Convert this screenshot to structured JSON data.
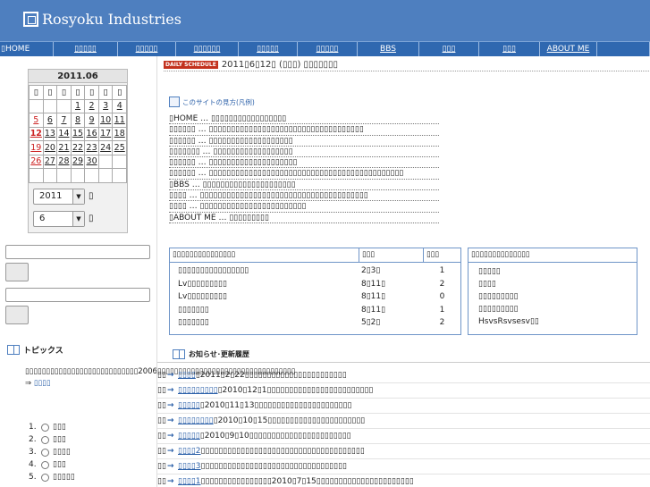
{
  "header": {
    "title": "Rosyoku Industries"
  },
  "nav": [
    {
      "label": "▯HOME",
      "w": 60
    },
    {
      "label": "▯▯▯▯▯",
      "w": 72
    },
    {
      "label": "▯▯▯▯▯",
      "w": 65
    },
    {
      "label": "▯▯▯▯▯▯",
      "w": 70
    },
    {
      "label": "▯▯▯▯▯",
      "w": 66
    },
    {
      "label": "▯▯▯▯▯",
      "w": 67
    },
    {
      "label": "BBS",
      "w": 69
    },
    {
      "label": "▯▯▯",
      "w": 67
    },
    {
      "label": "▯▯▯",
      "w": 68
    },
    {
      "label": "ABOUT ME",
      "w": 64
    },
    {
      "label": "",
      "w": 59
    }
  ],
  "calendar": {
    "title": "2011.06",
    "weekdays": [
      "▯",
      "▯",
      "▯",
      "▯",
      "▯",
      "▯",
      "▯"
    ],
    "weeks": [
      [
        "",
        "",
        "",
        "1",
        "2",
        "3",
        "4"
      ],
      [
        "5",
        "6",
        "7",
        "8",
        "9",
        "10",
        "11"
      ],
      [
        "12",
        "13",
        "14",
        "15",
        "16",
        "17",
        "18"
      ],
      [
        "19",
        "20",
        "21",
        "22",
        "23",
        "24",
        "25"
      ],
      [
        "26",
        "27",
        "28",
        "29",
        "30",
        "",
        ""
      ],
      [
        "",
        "",
        "",
        "",
        "",
        "",
        ""
      ]
    ],
    "today": "12",
    "year_select": "2011",
    "month_select": "6",
    "year_suffix": "▯",
    "month_suffix": "▯"
  },
  "topics": {
    "heading": "トピックス",
    "text": "▯▯▯▯▯▯▯▯▯▯▯▯▯▯▯▯▯▯▯▯▯▯▯▯▯▯▯2006▯▯▯▯▯▯▯▯▯▯▯▯▯▯▯▯▯▯▯▯▯▯▯▯▯▯▯▯▯▯▯▯▯ ⇒",
    "link": "▯▯▯▯",
    "poll": [
      {
        "num": "1.",
        "label": "▯▯▯"
      },
      {
        "num": "2.",
        "label": "▯▯▯"
      },
      {
        "num": "3.",
        "label": "▯▯▯▯"
      },
      {
        "num": "4.",
        "label": "▯▯▯"
      },
      {
        "num": "5.",
        "label": "▯▯▯▯▯"
      }
    ]
  },
  "daily": {
    "badge": "DAILY SCHEDULE",
    "date": "2011▯6▯12▯ (▯▯▯) ▯▯▯▯▯▯▯"
  },
  "guide": {
    "heading": "このサイトの見方(凡例)",
    "rows": [
      "▯HOME … ▯▯▯▯▯▯▯▯▯▯▯▯▯▯▯▯▯",
      "▯▯▯▯▯▯ … ▯▯▯▯▯▯▯▯▯▯▯▯▯▯▯▯▯▯▯▯▯▯▯▯▯▯▯▯▯▯▯▯▯▯▯",
      "▯▯▯▯▯▯ … ▯▯▯▯▯▯▯▯▯▯▯▯▯▯▯▯▯▯▯",
      "▯▯▯▯▯▯▯ … ▯▯▯▯▯▯▯▯▯▯▯▯▯▯▯▯▯▯",
      "▯▯▯▯▯▯ … ▯▯▯▯▯▯▯▯▯▯▯▯▯▯▯▯▯▯▯▯",
      "▯▯▯▯▯▯ … ▯▯▯▯▯▯▯▯▯▯▯▯▯▯▯▯▯▯▯▯▯▯▯▯▯▯▯▯▯▯▯▯▯▯▯▯▯▯▯▯▯▯▯▯",
      "▯BBS … ▯▯▯▯▯▯▯▯▯▯▯▯▯▯▯▯▯▯▯▯▯",
      "▯▯▯▯ … ▯▯▯▯▯▯▯▯▯▯▯▯▯▯▯▯▯▯▯▯▯▯▯▯▯▯▯▯▯▯▯▯▯▯▯▯▯▯",
      "▯▯▯▯ … ▯▯▯▯▯▯▯▯▯▯▯▯▯▯▯▯▯▯▯▯▯▯▯▯",
      "▯ABOUT ME … ▯▯▯▯▯▯▯▯▯"
    ]
  },
  "table": {
    "headers": [
      "▯▯▯▯▯▯▯▯▯▯▯▯▯▯▯",
      "▯▯▯",
      "▯▯▯"
    ],
    "rows": [
      [
        "▯▯▯▯▯▯▯▯▯▯▯▯▯▯▯▯",
        "2▯3▯",
        "1"
      ],
      [
        "Lv▯▯▯▯▯▯▯▯▯",
        "8▯11▯",
        "2"
      ],
      [
        "Lv▯▯▯▯▯▯▯▯▯",
        "8▯11▯",
        "0"
      ],
      [
        "▯▯▯▯▯▯▯",
        "8▯11▯",
        "1"
      ],
      [
        "▯▯▯▯▯▯▯",
        "5▯2▯",
        "2"
      ]
    ]
  },
  "sidebox": {
    "heading": "▯▯▯▯▯▯▯▯▯▯▯▯▯▯",
    "items": [
      "▯▯▯▯▯",
      "▯▯▯▯",
      "▯▯▯▯▯▯▯▯▯",
      "▯▯▯▯▯▯▯▯▯",
      "HsvsRsvsesv▯▯"
    ]
  },
  "news": {
    "heading": "お知らせ･更新履歴",
    "rows": [
      {
        "link": "▯▯▯▯",
        "text": "▯2011▯2▯22▯▯▯▯▯▯▯▯▯▯▯▯▯▯▯▯▯▯▯▯▯▯▯"
      },
      {
        "link": "▯▯▯▯▯▯▯▯▯",
        "text": "▯2010▯12▯1▯▯▯▯▯▯▯▯▯▯▯▯▯▯▯▯▯▯▯▯▯▯▯▯"
      },
      {
        "link": "▯▯▯▯▯",
        "text": "▯2010▯11▯13▯▯▯▯▯▯▯▯▯▯▯▯▯▯▯▯▯▯▯▯▯▯"
      },
      {
        "link": "▯▯▯▯▯▯▯▯",
        "text": "▯2010▯10▯15▯▯▯▯▯▯▯▯▯▯▯▯▯▯▯▯▯▯▯▯▯▯"
      },
      {
        "link": "▯▯▯▯▯",
        "text": "▯2010▯9▯10▯▯▯▯▯▯▯▯▯▯▯▯▯▯▯▯▯▯▯▯▯▯▯"
      },
      {
        "link": "▯▯▯▯2",
        "text": "▯▯▯▯▯▯▯▯▯▯▯▯▯▯▯▯▯▯▯▯▯▯▯▯▯▯▯▯▯▯▯▯▯▯▯▯▯"
      },
      {
        "link": "▯▯▯▯3",
        "text": "▯▯▯▯▯▯▯▯▯▯▯▯▯▯▯▯▯▯▯▯▯▯▯▯▯▯▯▯▯▯▯▯▯"
      },
      {
        "link": "▯▯▯▯1",
        "text": "▯▯▯▯▯▯▯▯▯▯▯▯▯▯▯▯2010▯7▯15▯▯▯▯▯▯▯▯▯▯▯▯▯▯▯▯▯▯▯▯▯▯"
      },
      {
        "link": "▯▯▯▯",
        "text": "▯▯▯▯▯▯2010▯6▯5▯▯▯▯▯▯▯▯▯▯▯▯▯▯▯▯▯▯▯▯"
      }
    ]
  }
}
